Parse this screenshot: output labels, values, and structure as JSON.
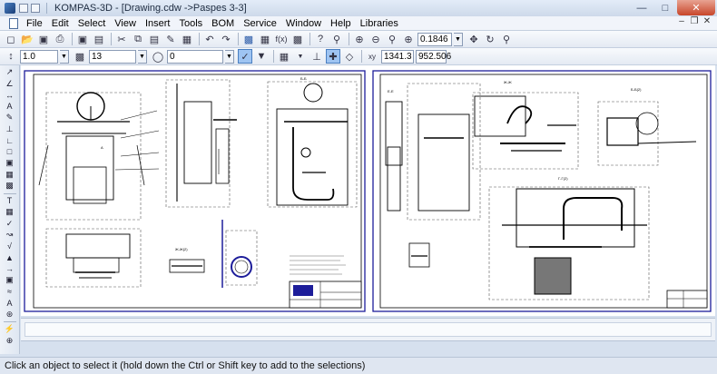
{
  "window": {
    "app_name": "KOMPAS-3D",
    "document_title": "[Drawing.cdw ->Paspes 3-3]"
  },
  "menu": [
    "File",
    "Edit",
    "Select",
    "View",
    "Insert",
    "Tools",
    "BOM",
    "Service",
    "Window",
    "Help",
    "Libraries"
  ],
  "toolbar_top": {
    "zoom_value": "0.1846"
  },
  "toolbar_props": {
    "line_scale": "1.0",
    "layer_value": "13",
    "style_value": "0",
    "coord_x": "1341.3",
    "coord_y": "952.506"
  },
  "drawing": {
    "sheet1_views": [
      "A",
      "Б-Б",
      "Г",
      "Д",
      "Вид А",
      "Б-А(2)",
      "Ж-Ж(2)"
    ],
    "sheet2_views": [
      "Е-Е",
      "Ж-Ж",
      "Б-Б(2)",
      "Г-Г(2)",
      "Д-Д",
      "Е-Е(2)"
    ]
  },
  "status": {
    "hint": "Click an object to select it (hold down the Ctrl or Shift key to add to the selections)"
  },
  "colors": {
    "frame": "#1d1d9a",
    "linework": "#000000",
    "dashed": "#555555",
    "background": "#ffffff"
  }
}
